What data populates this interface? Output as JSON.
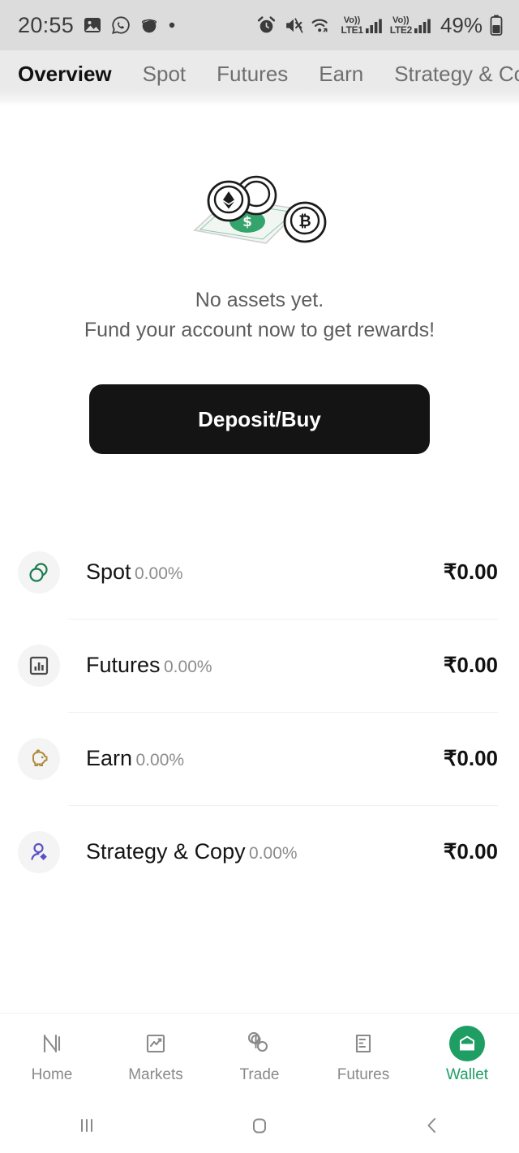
{
  "status_bar": {
    "time": "20:55",
    "battery_text": "49%",
    "left_icons": [
      "photos-icon",
      "whatsapp-icon",
      "app-bubble-icon",
      "dot-icon"
    ],
    "right_icons": [
      "alarm-icon",
      "mute-icon",
      "wifi-icon",
      "volte1-signal-icon",
      "volte2-signal-icon",
      "battery-icon"
    ],
    "volte1_label_top": "Vo))",
    "volte1_label_bottom": "LTE1",
    "volte2_label_top": "Vo))",
    "volte2_label_bottom": "LTE2"
  },
  "tabs": [
    {
      "label": "Overview",
      "active": true
    },
    {
      "label": "Spot",
      "active": false
    },
    {
      "label": "Futures",
      "active": false
    },
    {
      "label": "Earn",
      "active": false
    },
    {
      "label": "Strategy & Copy",
      "active": false
    }
  ],
  "empty_state": {
    "illustration": "coins-and-banknote-illustration",
    "line1": "No assets yet.",
    "line2": "Fund your account now to get rewards!",
    "cta_label": "Deposit/Buy"
  },
  "accounts": [
    {
      "name": "Spot",
      "percent": "0.00%",
      "amount": "₹0.00",
      "icon": "spot-rings-icon",
      "icon_color": "#1b7c4f"
    },
    {
      "name": "Futures",
      "percent": "0.00%",
      "amount": "₹0.00",
      "icon": "futures-barchart-icon",
      "icon_color": "#4a4a4a"
    },
    {
      "name": "Earn",
      "percent": "0.00%",
      "amount": "₹0.00",
      "icon": "earn-piggybank-icon",
      "icon_color": "#b08a3c"
    },
    {
      "name": "Strategy & Copy",
      "percent": "0.00%",
      "amount": "₹0.00",
      "icon": "strategy-person-icon",
      "icon_color": "#5a51c4"
    }
  ],
  "bottom_nav": [
    {
      "label": "Home",
      "icon": "home-logo-icon",
      "active": false
    },
    {
      "label": "Markets",
      "icon": "markets-chart-icon",
      "active": false
    },
    {
      "label": "Trade",
      "icon": "trade-circles-icon",
      "active": false
    },
    {
      "label": "Futures",
      "icon": "futures-document-icon",
      "active": false
    },
    {
      "label": "Wallet",
      "icon": "wallet-icon",
      "active": true
    }
  ],
  "android_nav": [
    {
      "icon": "recents-icon"
    },
    {
      "icon": "home-square-icon"
    },
    {
      "icon": "back-chevron-icon"
    }
  ],
  "colors": {
    "accent_green": "#1e9e63",
    "cta_black": "#141414",
    "status_bar_bg": "#dcdcdc",
    "tab_bar_bg": "#eaeaea"
  }
}
